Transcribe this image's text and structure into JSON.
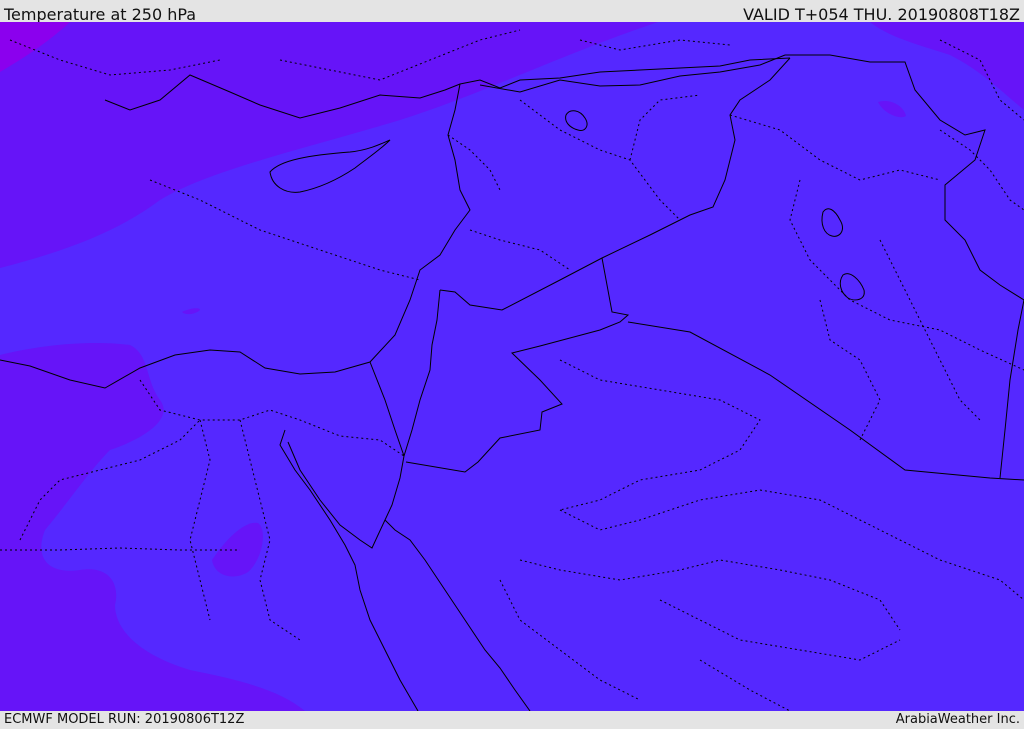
{
  "header": {
    "title": "Temperature at 250 hPa",
    "valid_time": "VALID T+054 THU. 20190808T18Z"
  },
  "footer": {
    "model_run": "ECMWF MODEL RUN: 20190806T12Z",
    "credit": "ArabiaWeather Inc."
  },
  "map": {
    "colors": {
      "dominant_fill": "#5528ff",
      "cooler_band": "#6614f8",
      "coldest_corner": "#8b00ee",
      "borders": "#000000",
      "background": "#e4e4e4"
    }
  }
}
